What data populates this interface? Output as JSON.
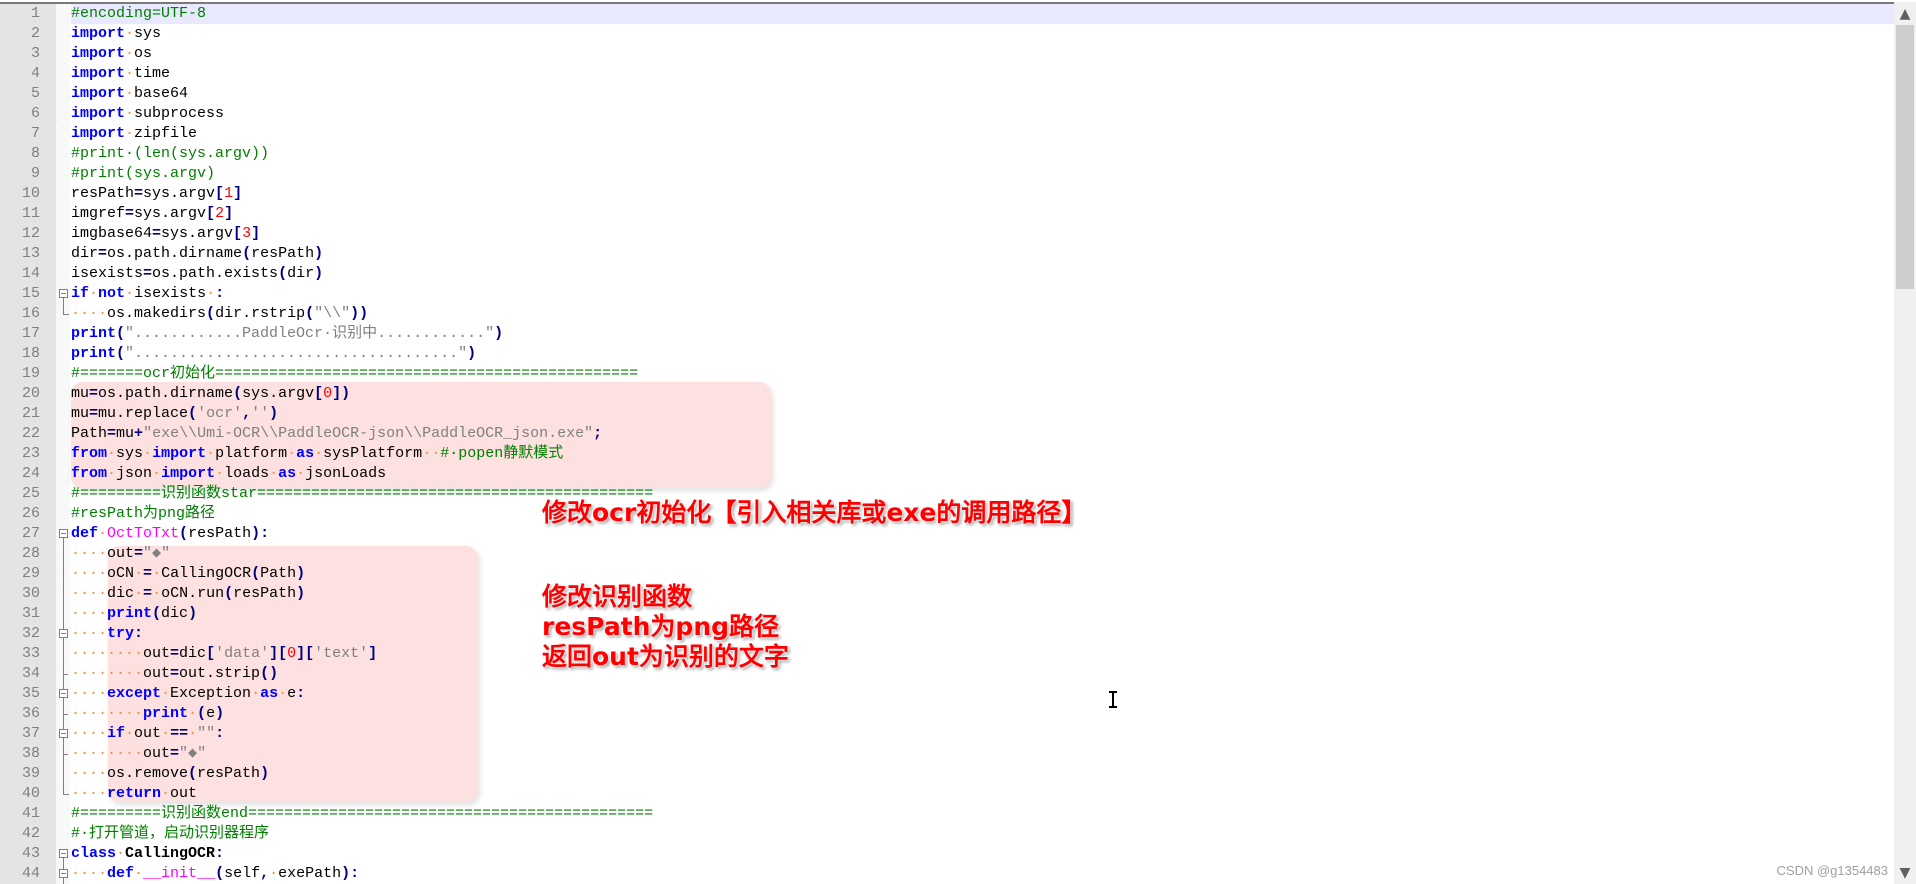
{
  "editor": {
    "current_line": 1,
    "lines": [
      {
        "n": "1",
        "html": "<span class='cm'>#encoding=UTF-8</span>"
      },
      {
        "n": "2",
        "html": "<span class='kw'>import</span><span class='ws'>·</span>sys"
      },
      {
        "n": "3",
        "html": "<span class='kw'>import</span><span class='ws'>·</span>os"
      },
      {
        "n": "4",
        "html": "<span class='kw'>import</span><span class='ws'>·</span>time"
      },
      {
        "n": "5",
        "html": "<span class='kw'>import</span><span class='ws'>·</span>base64"
      },
      {
        "n": "6",
        "html": "<span class='kw'>import</span><span class='ws'>·</span>subprocess"
      },
      {
        "n": "7",
        "html": "<span class='kw'>import</span><span class='ws'>·</span>zipfile"
      },
      {
        "n": "8",
        "html": "<span class='cm'>#print·(len(sys.argv))</span>"
      },
      {
        "n": "9",
        "html": "<span class='cm'>#print(sys.argv)</span>"
      },
      {
        "n": "10",
        "html": "resPath<span class='op'>=</span>sys.argv<span class='op'>[</span><span class='num'>1</span><span class='op'>]</span>"
      },
      {
        "n": "11",
        "html": "imgref<span class='op'>=</span>sys.argv<span class='op'>[</span><span class='num'>2</span><span class='op'>]</span>"
      },
      {
        "n": "12",
        "html": "imgbase64<span class='op'>=</span>sys.argv<span class='op'>[</span><span class='num'>3</span><span class='op'>]</span>"
      },
      {
        "n": "13",
        "html": "dir<span class='op'>=</span>os.path.dirname<span class='op'>(</span>resPath<span class='op'>)</span>"
      },
      {
        "n": "14",
        "html": "isexists<span class='op'>=</span>os.path.exists<span class='op'>(</span>dir<span class='op'>)</span>"
      },
      {
        "n": "15",
        "fold": "box",
        "html": "<span class='kw'>if</span><span class='ws'>·</span><span class='kw'>not</span><span class='ws'>·</span>isexists<span class='ws'>·</span><span class='op'>:</span>"
      },
      {
        "n": "16",
        "fold": "end",
        "html": "<span class='ws'>····</span>os.makedirs<span class='op'>(</span>dir.rstrip<span class='op'>(</span><span class='str'>\"\\\\\"</span><span class='op'>))</span>"
      },
      {
        "n": "17",
        "html": "<span class='kw'>print</span><span class='op'>(</span><span class='str'>\"............PaddleOcr·识别中............\"</span><span class='op'>)</span>"
      },
      {
        "n": "18",
        "html": "<span class='kw'>print</span><span class='op'>(</span><span class='str'>\"....................................\"</span><span class='op'>)</span>"
      },
      {
        "n": "19",
        "html": "<span class='cm'>#=======ocr初始化===============================================</span>"
      },
      {
        "n": "20",
        "html": "mu<span class='op'>=</span>os.path.dirname<span class='op'>(</span>sys.argv<span class='op'>[</span><span class='num'>0</span><span class='op'>])</span>"
      },
      {
        "n": "21",
        "html": "mu<span class='op'>=</span>mu.replace<span class='op'>(</span><span class='str'>'ocr'</span><span class='op'>,</span><span class='str'>''</span><span class='op'>)</span>"
      },
      {
        "n": "22",
        "html": "Path<span class='op'>=</span>mu<span class='op'>+</span><span class='str'>\"exe\\\\Umi-OCR\\\\PaddleOCR-json\\\\PaddleOCR_json.exe\"</span><span class='op'>;</span>"
      },
      {
        "n": "23",
        "html": "<span class='kw'>from</span><span class='ws'>·</span>sys<span class='ws'>·</span><span class='kw'>import</span><span class='ws'>·</span>platform<span class='ws'>·</span><span class='kw'>as</span><span class='ws'>·</span>sysPlatform<span class='ws'>··</span><span class='cm'>#·popen静默模式</span>"
      },
      {
        "n": "24",
        "html": "<span class='kw'>from</span><span class='ws'>·</span>json<span class='ws'>·</span><span class='kw'>import</span><span class='ws'>·</span>loads<span class='ws'>·</span><span class='kw'>as</span><span class='ws'>·</span>jsonLoads"
      },
      {
        "n": "25",
        "html": "<span class='cm'>#=========识别函数star============================================</span>"
      },
      {
        "n": "26",
        "html": "<span class='cm'>#resPath为png路径</span>"
      },
      {
        "n": "27",
        "fold": "box",
        "html": "<span class='kw'>def</span><span class='ws'>·</span><span class='fn'>OctToTxt</span><span class='op'>(</span>resPath<span class='op'>):</span>"
      },
      {
        "n": "28",
        "fold": "line",
        "html": "<span class='ws'>····</span>out<span class='op'>=</span><span class='str'>\"◆\"</span>"
      },
      {
        "n": "29",
        "fold": "line",
        "html": "<span class='ws'>····</span>oCN<span class='ws'>·</span><span class='op'>=</span><span class='ws'>·</span>CallingOCR<span class='op'>(</span>Path<span class='op'>)</span>"
      },
      {
        "n": "30",
        "fold": "line",
        "html": "<span class='ws'>····</span>dic<span class='ws'>·</span><span class='op'>=</span><span class='ws'>·</span>oCN.run<span class='op'>(</span>resPath<span class='op'>)</span>"
      },
      {
        "n": "31",
        "fold": "line",
        "html": "<span class='ws'>····</span><span class='kw'>print</span><span class='op'>(</span>dic<span class='op'>)</span>"
      },
      {
        "n": "32",
        "fold": "box",
        "html": "<span class='ws'>····</span><span class='kw'>try</span><span class='op'>:</span>"
      },
      {
        "n": "33",
        "fold": "line",
        "html": "<span class='ws'>········</span>out<span class='op'>=</span>dic<span class='op'>[</span><span class='str'>'data'</span><span class='op'>][</span><span class='num'>0</span><span class='op'>][</span><span class='str'>'text'</span><span class='op'>]</span>"
      },
      {
        "n": "34",
        "fold": "tee",
        "html": "<span class='ws'>········</span>out<span class='op'>=</span>out.strip<span class='op'>()</span>"
      },
      {
        "n": "35",
        "fold": "box",
        "html": "<span class='ws'>····</span><span class='kw'>except</span><span class='ws'>·</span>Exception<span class='ws'>·</span><span class='kw'>as</span><span class='ws'>·</span>e<span class='op'>:</span>"
      },
      {
        "n": "36",
        "fold": "tee",
        "html": "<span class='ws'>········</span><span class='kw'>print</span><span class='ws'>·</span><span class='op'>(</span>e<span class='op'>)</span>"
      },
      {
        "n": "37",
        "fold": "box",
        "html": "<span class='ws'>····</span><span class='kw'>if</span><span class='ws'>·</span>out<span class='ws'>·</span><span class='op'>==</span><span class='ws'>·</span><span class='str'>\"\"</span><span class='op'>:</span>"
      },
      {
        "n": "38",
        "fold": "tee",
        "html": "<span class='ws'>········</span>out<span class='op'>=</span><span class='str'>\"◆\"</span>"
      },
      {
        "n": "39",
        "fold": "line",
        "html": "<span class='ws'>····</span>os.remove<span class='op'>(</span>resPath<span class='op'>)</span>"
      },
      {
        "n": "40",
        "fold": "end",
        "html": "<span class='ws'>····</span><span class='kw'>return</span><span class='ws'>·</span>out"
      },
      {
        "n": "41",
        "html": "<span class='cm'>#=========识别函数end=============================================</span>"
      },
      {
        "n": "42",
        "html": "<span class='cm'>#·打开管道，启动识别器程序</span>"
      },
      {
        "n": "43",
        "fold": "box",
        "html": "<span class='kw'>class</span><span class='ws'>·</span><span class='cls'>CallingOCR</span><span class='op'>:</span>"
      },
      {
        "n": "44",
        "fold": "box",
        "html": "<span class='ws'>····</span><span class='kw'>def</span><span class='ws'>·</span><span class='fn'>__init__</span><span class='op'>(</span>self<span class='op'>,</span><span class='ws'>·</span>exePath<span class='op'>):</span>"
      }
    ]
  },
  "annotations": {
    "init_note": "修改ocr初始化【引入相关库或exe的调用路径】",
    "func_note": "修改识别函数\nresPath为png路径\n返回out为识别的文字"
  },
  "colors": {
    "highlight": "#fde0e0",
    "annotation": "#ff0000",
    "keyword": "#0000ff",
    "comment": "#008000"
  },
  "scrollbar": {
    "up_icon": "▲",
    "down_icon": "▼"
  },
  "watermark": "CSDN @g1354483"
}
